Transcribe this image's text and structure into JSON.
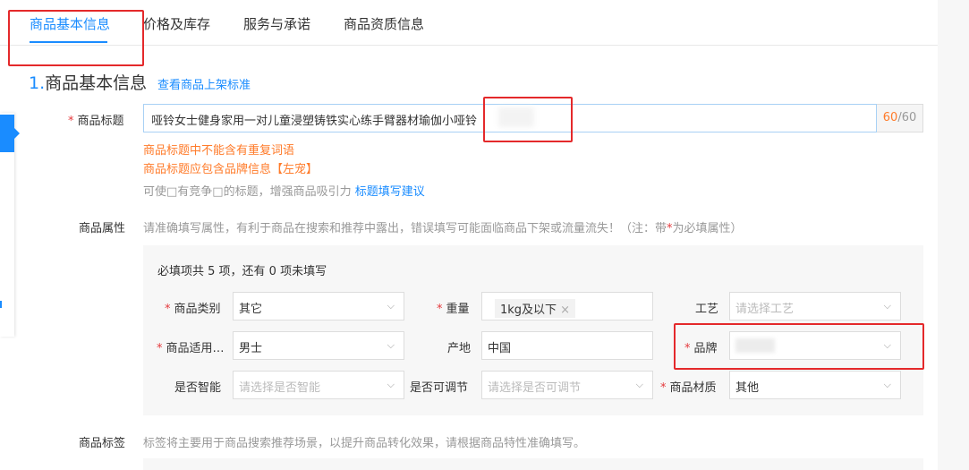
{
  "tabs": [
    {
      "label": "商品基本信息"
    },
    {
      "label": "价格及库存"
    },
    {
      "label": "服务与承诺"
    },
    {
      "label": "商品资质信息"
    }
  ],
  "section": {
    "number": "1.",
    "title": "商品基本信息",
    "link": "查看商品上架标准"
  },
  "title_field": {
    "label": "商品标题",
    "value": "哑铃女士健身家用一对儿童浸塑铸铁实心练手臂器材瑜伽小哑铃",
    "count_current": "60",
    "count_max": "/60",
    "warnings": [
      "商品标题中不能含有重复词语",
      "商品标题应包含品牌信息【左宠】"
    ],
    "hint": "可使□有竞争□的标题，增强商品吸引力",
    "hint_link": "标题填写建议"
  },
  "attributes": {
    "label": "商品属性",
    "note_before": "请准确填写属性，有利于商品在搜索和推荐中露出，错误填写可能面临商品下架或流量流失！（注：带",
    "note_star": "*",
    "note_after": "为必填属性）",
    "required_count": "必填项共 5 项，还有 0 项未填写",
    "fields": {
      "category": {
        "label": "商品类别",
        "value": "其它"
      },
      "weight": {
        "label": "重量",
        "value": "1kg及以下"
      },
      "craft": {
        "label": "工艺",
        "placeholder": "请选择工艺"
      },
      "gender": {
        "label": "商品适用…",
        "value": "男士"
      },
      "origin": {
        "label": "产地",
        "value": "中国"
      },
      "brand": {
        "label": "品牌",
        "value": ""
      },
      "smart": {
        "label": "是否智能",
        "placeholder": "请选择是否智能"
      },
      "adjustable": {
        "label": "是否可调节",
        "placeholder": "请选择是否可调节"
      },
      "material": {
        "label": "商品材质",
        "value": "其他"
      }
    }
  },
  "tags": {
    "label": "商品标签",
    "note": "标签将主要用于商品搜索推荐场景，以提升商品转化效果，请根据商品特性准确填写。"
  },
  "icons": {
    "chevron": "chevron-down-icon",
    "close": "close-icon"
  },
  "colors": {
    "accent": "#1a8cff",
    "warning": "#ff7b2a",
    "required": "#e4393c",
    "annotation": "#e4292b"
  }
}
